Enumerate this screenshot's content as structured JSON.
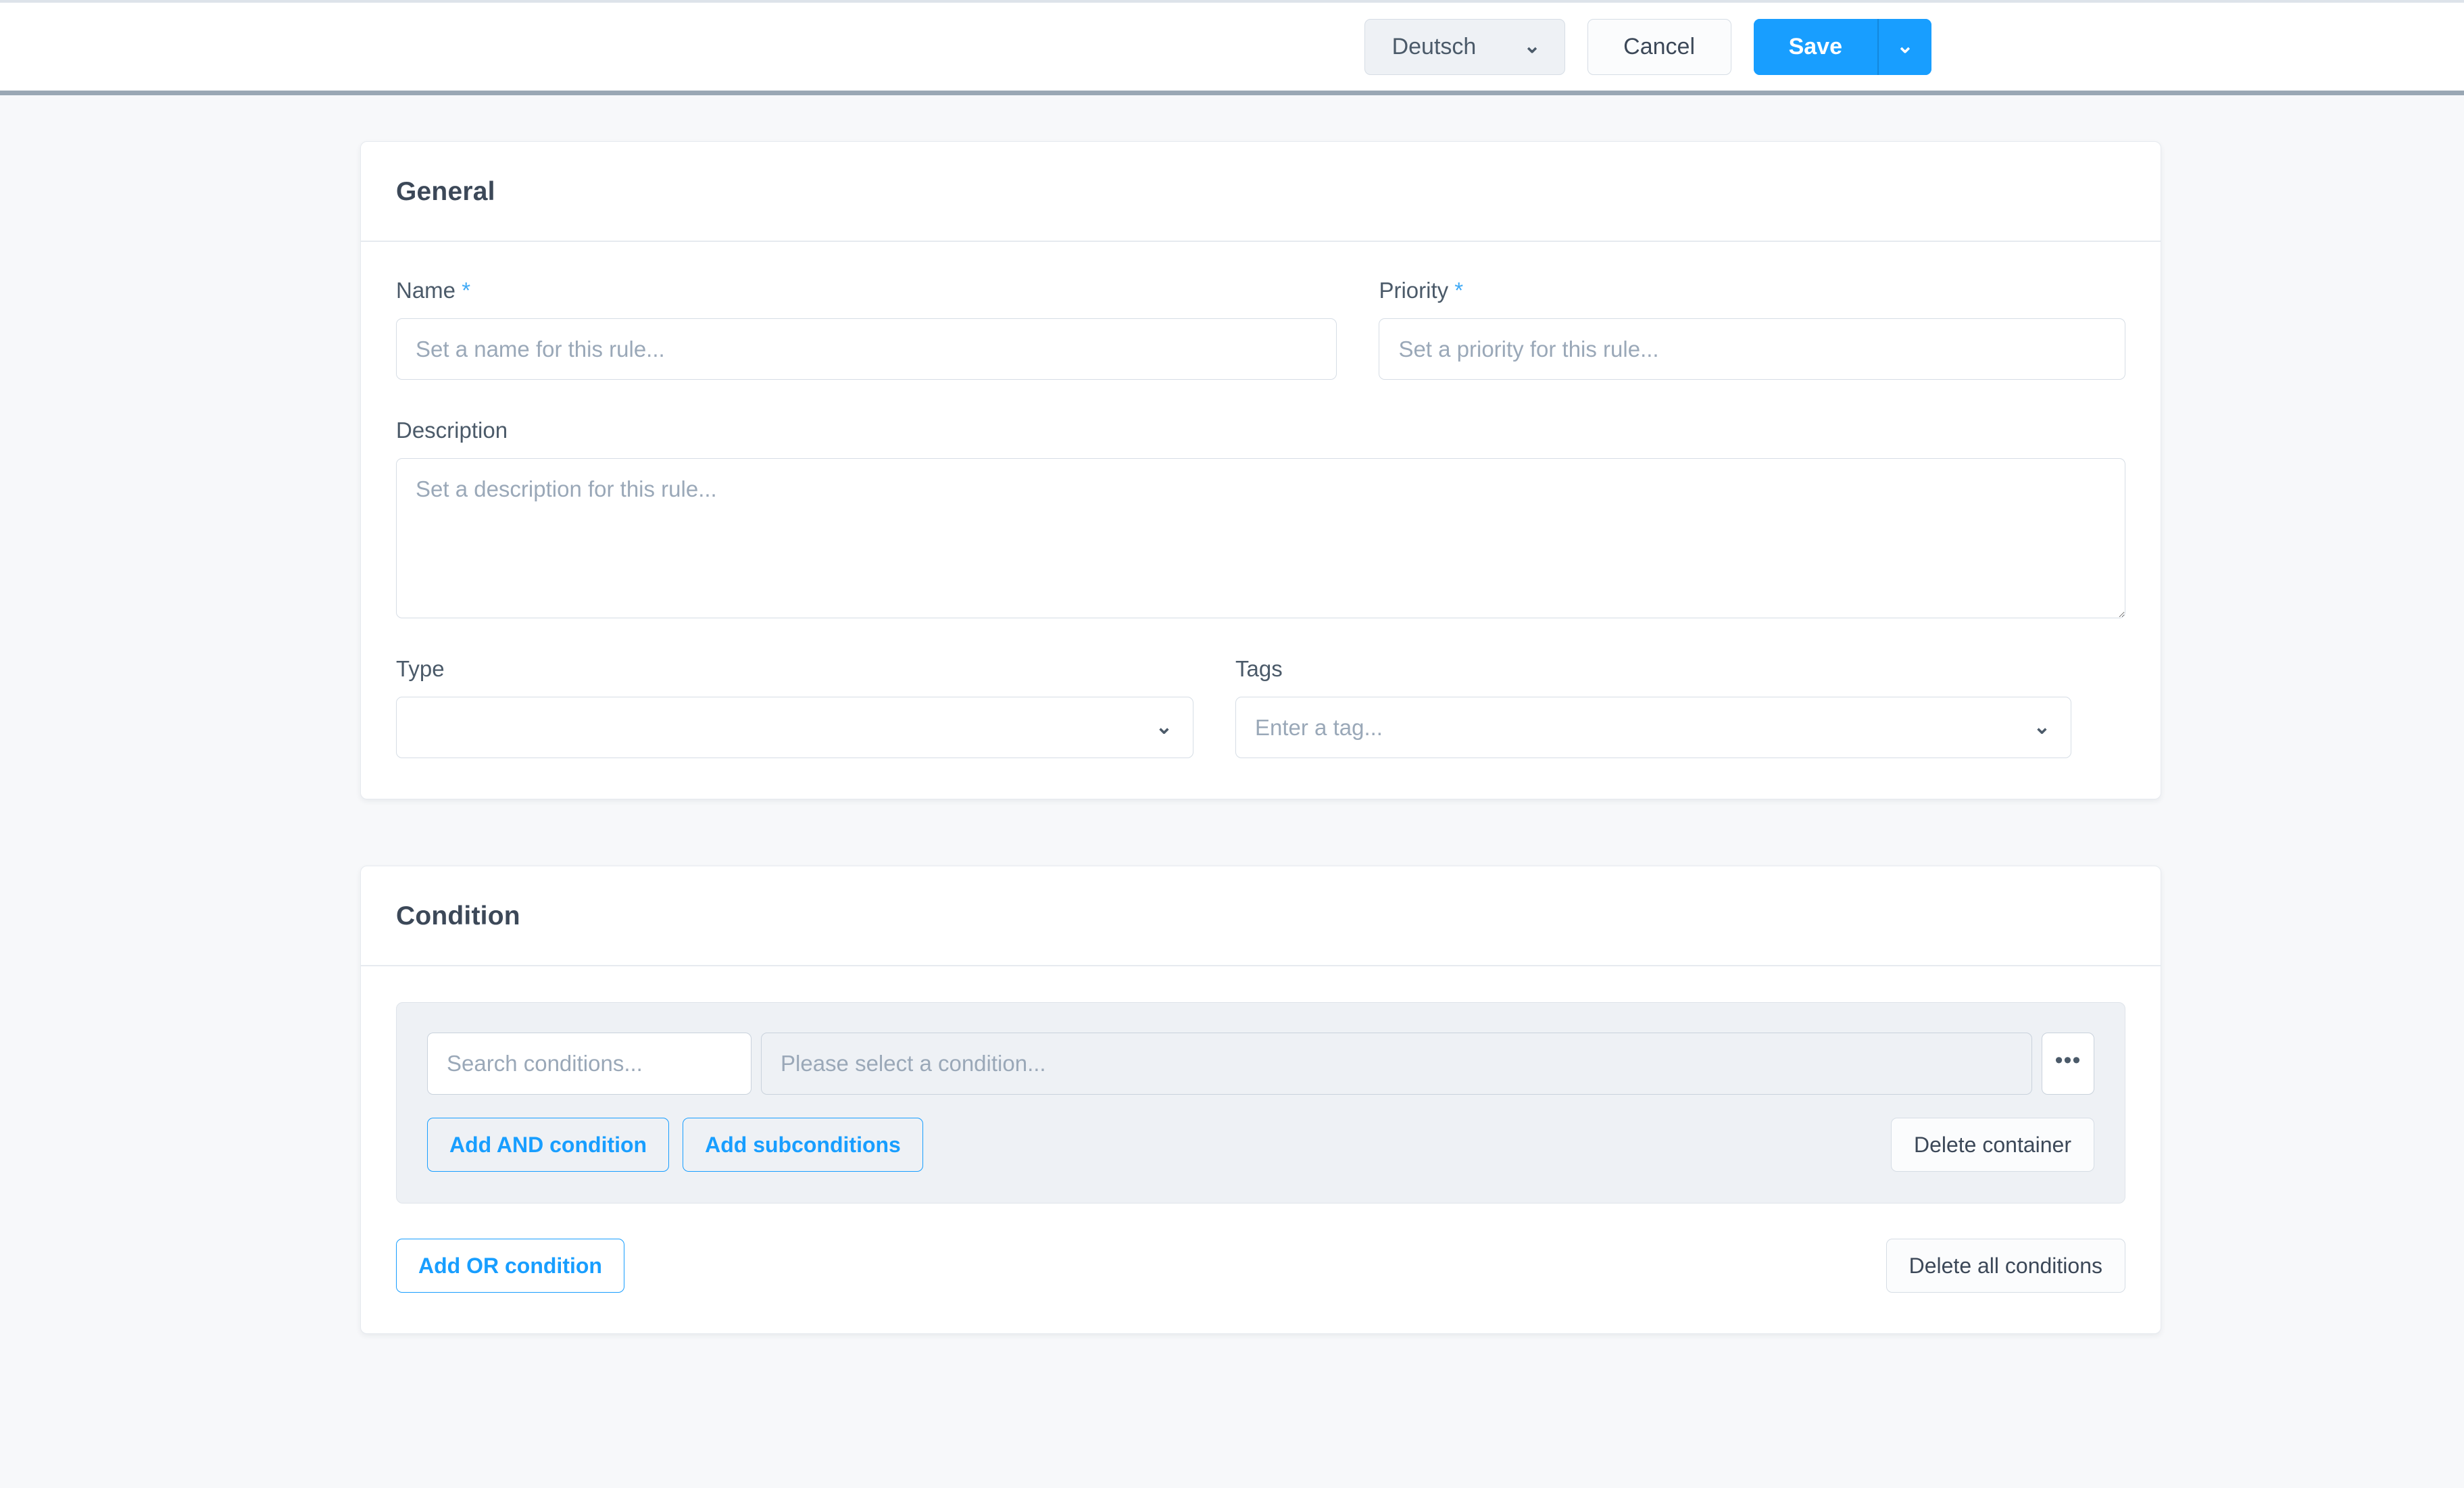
{
  "topbar": {
    "language_selected": "Deutsch",
    "language_chevron": "⌄",
    "cancel_label": "Cancel",
    "save_label": "Save",
    "save_caret": "⌄"
  },
  "general": {
    "title": "General",
    "name": {
      "label": "Name",
      "required_mark": "*",
      "placeholder": "Set a name for this rule...",
      "value": ""
    },
    "priority": {
      "label": "Priority",
      "required_mark": "*",
      "placeholder": "Set a priority for this rule...",
      "value": ""
    },
    "description": {
      "label": "Description",
      "placeholder": "Set a description for this rule...",
      "value": ""
    },
    "type": {
      "label": "Type",
      "value": "",
      "chevron": "⌄"
    },
    "tags": {
      "label": "Tags",
      "placeholder": "Enter a tag...",
      "value": "",
      "chevron": "⌄"
    }
  },
  "condition": {
    "title": "Condition",
    "search_placeholder": "Search conditions...",
    "search_value": "",
    "select_placeholder": "Please select a condition...",
    "more_label": "•••",
    "add_and_label": "Add AND condition",
    "add_subconditions_label": "Add subconditions",
    "delete_container_label": "Delete container",
    "add_or_label": "Add OR condition",
    "delete_all_label": "Delete all conditions"
  },
  "colors": {
    "accent": "#189eff",
    "required": "#3fa9f5",
    "page_bg": "#f7f8fa",
    "card_bg": "#ffffff",
    "container_bg": "#eef1f5",
    "border": "#d6dde5",
    "text": "#3c4858",
    "placeholder": "#9aa8b8"
  }
}
